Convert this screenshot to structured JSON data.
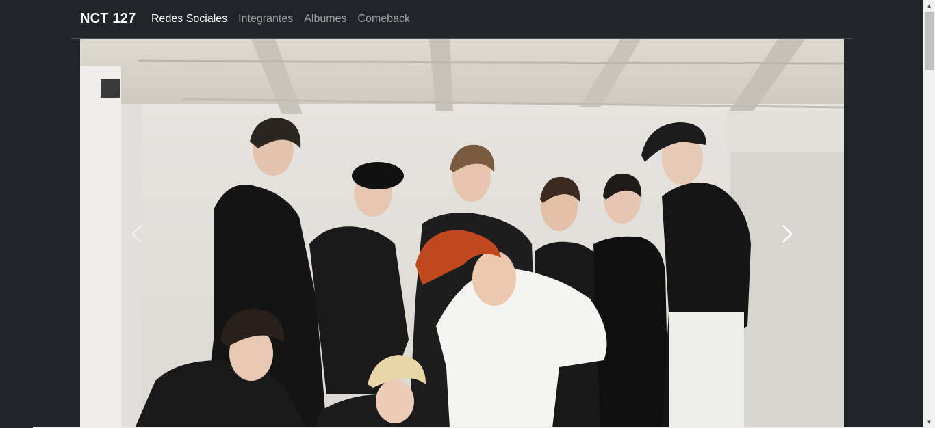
{
  "navbar": {
    "brand": "NCT 127",
    "links": [
      {
        "label": "Redes Sociales",
        "active": true
      },
      {
        "label": "Integrantes",
        "active": false
      },
      {
        "label": "Albumes",
        "active": false
      },
      {
        "label": "Comeback",
        "active": false
      }
    ]
  },
  "carousel": {
    "prev_icon": "chevron-left-icon",
    "next_icon": "chevron-right-icon"
  },
  "scrollbar": {
    "up_arrow": "▲",
    "down_arrow": "▼"
  }
}
